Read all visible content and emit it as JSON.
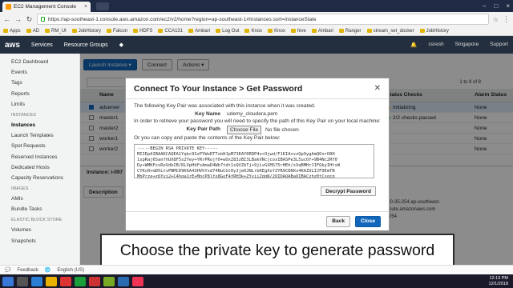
{
  "browser": {
    "tab_title": "EC2 Management Console",
    "url": "https://ap-southeast-1.console.aws.amazon.com/ec2/v2/home?region=ap-southeast-1#Instances:sort=instanceState",
    "bookmarks": [
      "Apps",
      "AD",
      "RM_UI",
      "JobHistory",
      "Falcon",
      "HDFS",
      "CCA131",
      "Ambari",
      "Log Out",
      "Knox",
      "Knox",
      "hive",
      "Ambari",
      "Ranger",
      "stream_set_docker",
      "JobHistory"
    ]
  },
  "aws_header": {
    "logo": "aws",
    "services": "Services",
    "resource_groups": "Resource Groups",
    "user": "ssresh",
    "region": "Singapore",
    "support": "Support"
  },
  "sidebar": {
    "items_top": [
      "EC2 Dashboard",
      "Events",
      "Tags",
      "Reports",
      "Limits"
    ],
    "instances_head": "INSTANCES",
    "instances_items": [
      "Instances",
      "Launch Templates",
      "Spot Requests",
      "Reserved Instances",
      "Dedicated Hosts",
      "Capacity Reservations"
    ],
    "images_head": "IMAGES",
    "images_items": [
      "AMIs",
      "Bundle Tasks"
    ],
    "ebs_head": "ELASTIC BLOCK STORE",
    "ebs_items": [
      "Volumes",
      "Snapshots"
    ]
  },
  "toolbar": {
    "launch": "Launch Instance",
    "connect": "Connect",
    "actions": "Actions"
  },
  "pager": "1 to 8 of 8",
  "table": {
    "headers": [
      "Name",
      "Status Checks",
      "Alarm Status"
    ],
    "rows": [
      {
        "name": "adserver",
        "status": "Initializing",
        "alarm": "None",
        "selected": true
      },
      {
        "name": "master1",
        "status": "2/2 checks passed",
        "alarm": "None",
        "selected": false
      },
      {
        "name": "master2",
        "status": "",
        "alarm": "None",
        "selected": false
      },
      {
        "name": "worker1",
        "status": "",
        "alarm": "None",
        "selected": false
      },
      {
        "name": "worker2",
        "status": "",
        "alarm": "None",
        "selected": false
      }
    ]
  },
  "detail": {
    "title": "Instance: i-097",
    "tab_description": "Description",
    "right_text": [
      "250-35-254.ap-southeast-",
      "mpute.amazonaws.com",
      "5.254"
    ]
  },
  "dialog": {
    "title": "Connect To Your Instance > Get Password",
    "close": "✕",
    "line1": "The following Key Pair was associated with this instance when it was created.",
    "key_name_label": "Key Name",
    "key_name_value": "udemy_cloudera.pem",
    "line2": "In order to retrieve your password you will need to specify the path of this Key Pair on your local machine:",
    "key_path_label": "Key Pair Path",
    "choose_file": "Choose File",
    "no_file": "No file chosen",
    "line3": "Or you can copy and paste the contents of the Key Pair below:",
    "key_content": "-----BEGIN RSA PRIVATE KEY-----\nMIIEpAIBAAKCAQEA1Yqkc9SzPYWoDTTxbHJpM73EAY0RDP4vrOjwd/F1KIAvvzQp9ygAmQOxrO0H\n1spRaj65anfhUX8F5s2Yey+YRrPRojf0+wOxZ83zBI3LBakVNcjcoxIBASPe3L5ucOf+9B4Nc2RY0\nDy+WMKFxvRoVdbIB/RLVpHbFxAmaD4Wb7tdt1sQVZbTj+9jLvGSMS75rHEh/sVqBMHrJIFQkyIHtxW\nCYKcR+mD5LtvPNMCD9K6A43HVhYxd74NuCGt0yJje6JNLrbKEgXofZYR9CDNXs4KAZULIJF9EmTN\nMbPrze+z6Yyi2+C4hqa1rE+MncP8lfo8GoF4fRH3k+ZYviiZdqN/2OIDAOABaOIBACzhz0tCsqcg",
    "decrypt": "Decrypt Password",
    "back": "Back",
    "close_btn": "Close"
  },
  "caption": "Choose the private key to generate password",
  "footer": {
    "feedback": "Feedback",
    "language": "English (US)"
  },
  "taskbar": {
    "time": "12:13 PM",
    "date": "12/1/2018"
  },
  "colors": {
    "aws_header": "#232f3e",
    "primary_button": "#1166bb",
    "selected_row": "#dceaf7",
    "taskbar": "#1a1a2a"
  }
}
